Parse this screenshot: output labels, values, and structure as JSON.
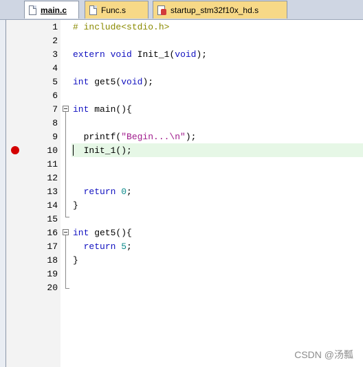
{
  "tabs": [
    {
      "label": "main.c"
    },
    {
      "label": "Func.s"
    },
    {
      "label": "startup_stm32f10x_hd.s"
    }
  ],
  "lines": [
    {
      "num": "1",
      "code": "# include<stdio.h>"
    },
    {
      "num": "2",
      "code": ""
    },
    {
      "num": "3",
      "code": "extern void Init_1(void);"
    },
    {
      "num": "4",
      "code": ""
    },
    {
      "num": "5",
      "code": "int get5(void);"
    },
    {
      "num": "6",
      "code": ""
    },
    {
      "num": "7",
      "code": "int main(){"
    },
    {
      "num": "8",
      "code": ""
    },
    {
      "num": "9",
      "code": "  printf(\"Begin...\\n\");"
    },
    {
      "num": "10",
      "code": "  Init_1();"
    },
    {
      "num": "11",
      "code": ""
    },
    {
      "num": "12",
      "code": ""
    },
    {
      "num": "13",
      "code": "  return 0;"
    },
    {
      "num": "14",
      "code": "}"
    },
    {
      "num": "15",
      "code": ""
    },
    {
      "num": "16",
      "code": "int get5(){"
    },
    {
      "num": "17",
      "code": "  return 5;"
    },
    {
      "num": "18",
      "code": "}"
    },
    {
      "num": "19",
      "code": ""
    },
    {
      "num": "20",
      "code": ""
    }
  ],
  "breakpoint_line": "10",
  "watermark": "CSDN @汤瓢",
  "colors": {
    "keyword": "#1010c0",
    "preprocessor": "#8a8a00",
    "string": "#a01b8c",
    "number": "#0a8a8a",
    "breakpoint": "#d40000",
    "current_line": "#e6f7e6",
    "tab_active": "#ffffff",
    "tab_inactive": "#f7d987"
  }
}
